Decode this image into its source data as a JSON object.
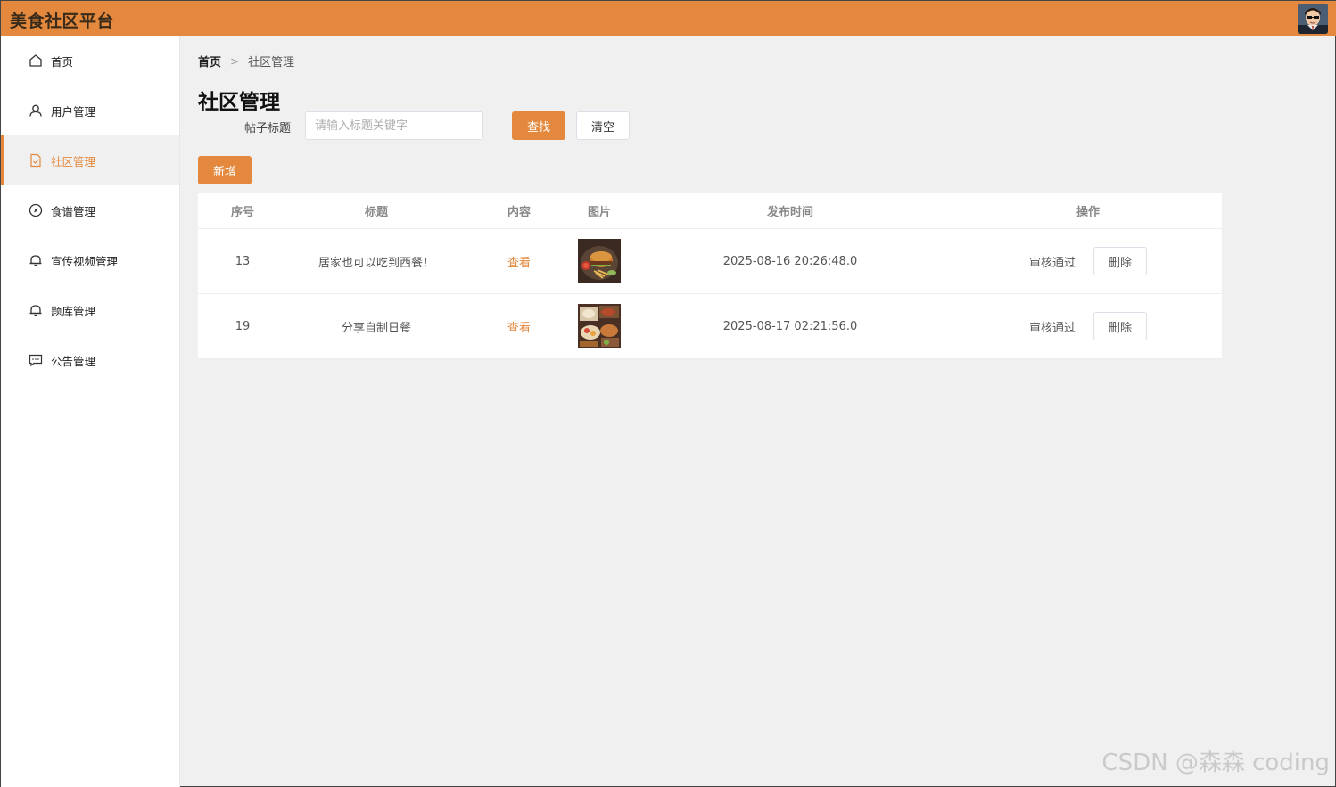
{
  "app": {
    "title": "美食社区平台"
  },
  "sidebar": {
    "items": [
      {
        "label": "首页",
        "icon": "home-icon"
      },
      {
        "label": "用户管理",
        "icon": "user-icon"
      },
      {
        "label": "社区管理",
        "icon": "document-check-icon",
        "active": true
      },
      {
        "label": "食谱管理",
        "icon": "compass-icon"
      },
      {
        "label": "宣传视频管理",
        "icon": "bell-icon"
      },
      {
        "label": "题库管理",
        "icon": "bell-icon"
      },
      {
        "label": "公告管理",
        "icon": "chat-icon"
      }
    ]
  },
  "breadcrumb": {
    "home": "首页",
    "current": "社区管理"
  },
  "page": {
    "title": "社区管理"
  },
  "search": {
    "label": "帖子标题",
    "placeholder": "请输入标题关键字",
    "value": ""
  },
  "buttons": {
    "find": "查找",
    "clear": "清空",
    "add": "新增"
  },
  "table": {
    "headers": {
      "id": "序号",
      "title": "标题",
      "content": "内容",
      "image": "图片",
      "time": "发布时间",
      "ops": "操作"
    },
    "rows": [
      {
        "id": "13",
        "title": "居家也可以吃到西餐！",
        "content_link": "查看",
        "image": "burger-plate-photo",
        "time": "2025-08-16 20:26:48.0",
        "approve": "审核通过",
        "delete": "删除"
      },
      {
        "id": "19",
        "title": "分享自制日餐",
        "content_link": "查看",
        "image": "japanese-dishes-photo",
        "time": "2025-08-17 02:21:56.0",
        "approve": "审核通过",
        "delete": "删除"
      }
    ]
  },
  "watermark": "CSDN @森森 coding",
  "colors": {
    "accent": "#e3883c",
    "background": "#f0f0f0"
  }
}
